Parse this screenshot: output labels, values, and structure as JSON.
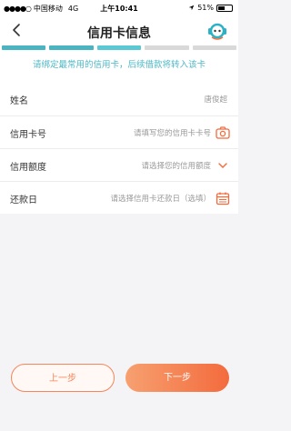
{
  "status_bar": {
    "carrier": "中国移动",
    "network": "4G",
    "time": "上午10:41",
    "battery_text": "51%",
    "battery_level": 0.51
  },
  "nav": {
    "title": "信用卡信息"
  },
  "progress": {
    "segments": [
      {
        "color": "#4ab4c0"
      },
      {
        "color": "#4ab4c0"
      },
      {
        "color": "#5bc9d4"
      },
      {
        "color": "#d9d9d9"
      },
      {
        "color": "#d9d9d9"
      }
    ]
  },
  "tip": "请绑定最常用的信用卡，后续借款将转入该卡",
  "form": {
    "name_label": "姓名",
    "name_value": "唐俊超",
    "card_label": "信用卡号",
    "card_placeholder": "请填写您的信用卡卡号",
    "limit_label": "信用额度",
    "limit_placeholder": "请选择您的信用额度",
    "due_label": "还款日",
    "due_placeholder": "请选择信用卡还款日（选填）"
  },
  "buttons": {
    "prev": "上一步",
    "next": "下一步"
  },
  "colors": {
    "accent": "#f36b3d",
    "teal": "#4ab4c0"
  },
  "icons": [
    "back-icon",
    "customer-service-icon",
    "camera-icon",
    "chevron-down-icon",
    "calendar-icon"
  ]
}
